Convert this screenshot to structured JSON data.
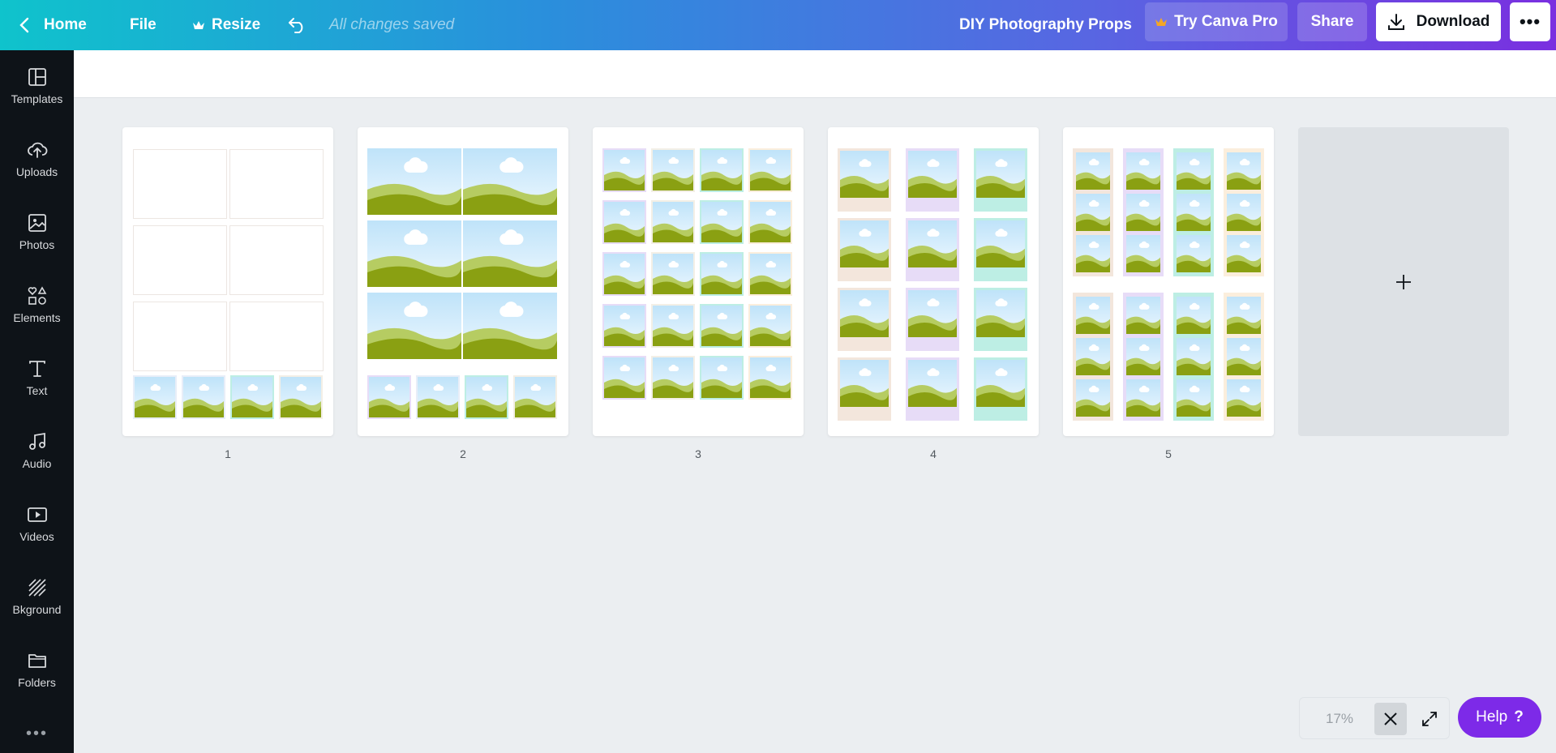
{
  "topbar": {
    "home_label": "Home",
    "file_label": "File",
    "resize_label": "Resize",
    "saved_status": "All changes saved",
    "design_title": "DIY Photography Props",
    "pro_label": "Try Canva Pro",
    "share_label": "Share",
    "download_label": "Download",
    "more_label": "•••",
    "pro_crown_color": "#f5a623"
  },
  "sidebar": {
    "items": [
      {
        "label": "Templates",
        "icon": "templates-icon"
      },
      {
        "label": "Uploads",
        "icon": "uploads-icon"
      },
      {
        "label": "Photos",
        "icon": "photos-icon"
      },
      {
        "label": "Elements",
        "icon": "elements-icon"
      },
      {
        "label": "Text",
        "icon": "text-icon"
      },
      {
        "label": "Audio",
        "icon": "audio-icon"
      },
      {
        "label": "Videos",
        "icon": "videos-icon"
      },
      {
        "label": "Bkground",
        "icon": "background-icon"
      },
      {
        "label": "Folders",
        "icon": "folders-icon"
      }
    ],
    "more_label": "•••"
  },
  "pages": [
    {
      "number": "1"
    },
    {
      "number": "2"
    },
    {
      "number": "3"
    },
    {
      "number": "4"
    },
    {
      "number": "5"
    }
  ],
  "add_page_label": "+",
  "zoom": {
    "level": "17%"
  },
  "help": {
    "label": "Help",
    "glyph": "?"
  },
  "colors": {
    "accent": "#7d2ae8",
    "sky_top": "#bfe3f9",
    "hill_dark": "#8aa012",
    "hill_light": "#b6cc62"
  }
}
